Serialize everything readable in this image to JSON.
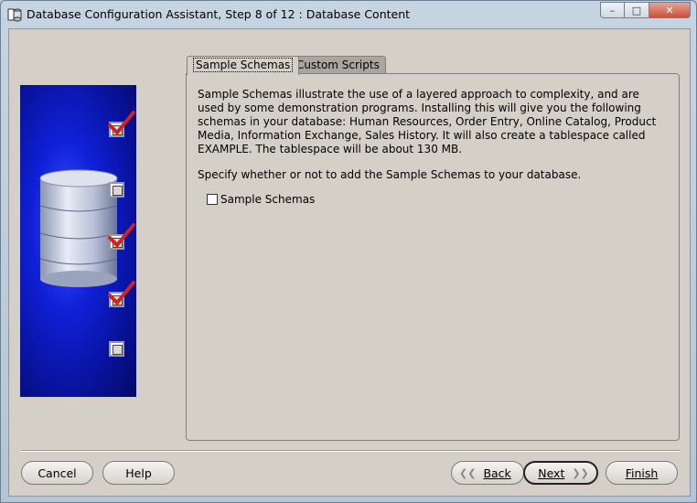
{
  "window": {
    "title": "Database Configuration Assistant, Step 8 of 12 : Database Content",
    "controls": {
      "minimize": "–",
      "maximize": "□",
      "close": "✕"
    }
  },
  "tabs": [
    {
      "label": "Sample Schemas",
      "active": true
    },
    {
      "label": "Custom Scripts",
      "active": false
    }
  ],
  "content": {
    "description": "Sample Schemas illustrate the use of a layered approach to complexity, and are used by some demonstration programs. Installing this will give you the following schemas in your database: Human Resources, Order Entry, Online Catalog, Product Media, Information Exchange, Sales History. It will also create a tablespace called EXAMPLE. The tablespace will be about 130 MB.",
    "prompt": "Specify whether or not to add the Sample Schemas to your database.",
    "checkbox_label": "Sample Schemas",
    "checkbox_checked": false
  },
  "steps": [
    {
      "checked": true
    },
    {
      "checked": false
    },
    {
      "checked": true
    },
    {
      "checked": true
    },
    {
      "checked": false
    }
  ],
  "buttons": {
    "cancel": "Cancel",
    "help": "Help",
    "back": "Back",
    "next": "Next",
    "finish": "Finish"
  },
  "colors": {
    "panel_blue": "#1020d8",
    "check_red": "#d42020",
    "dialog_bg": "#d4d0c8"
  }
}
